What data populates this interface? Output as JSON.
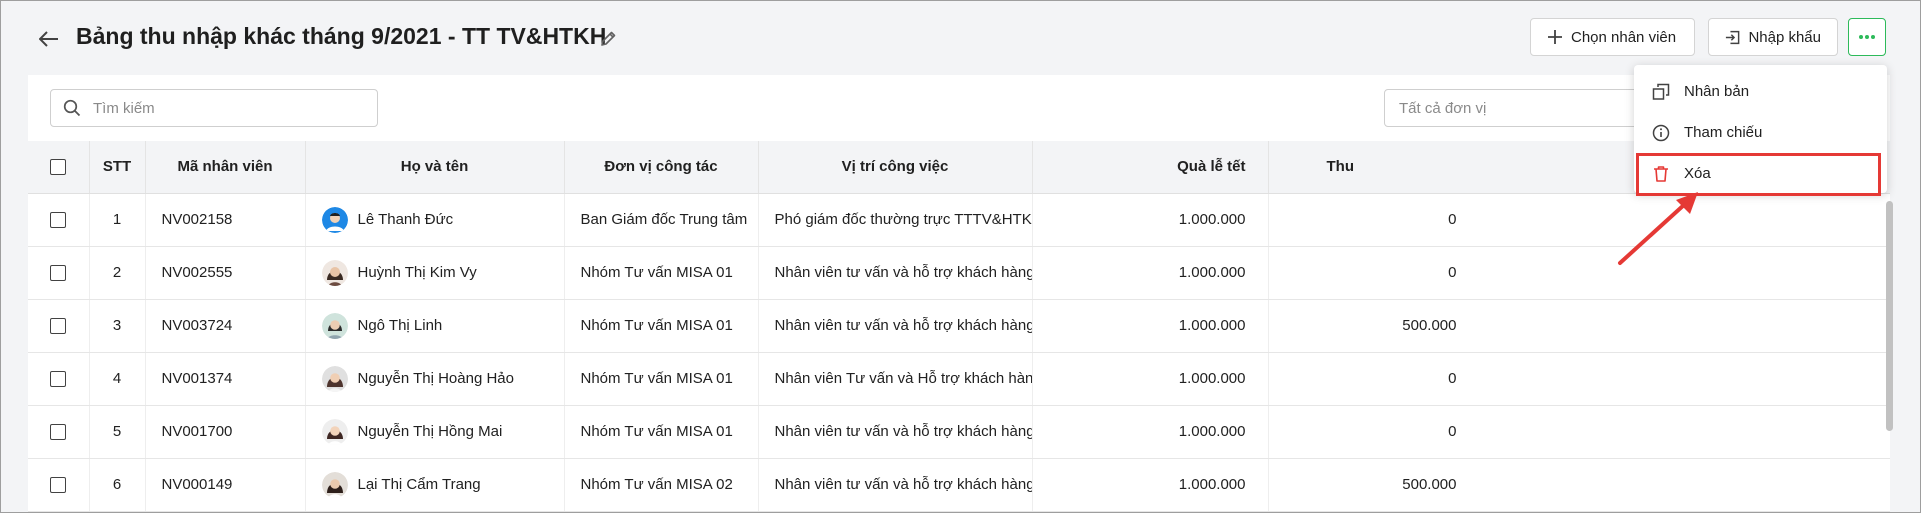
{
  "header": {
    "title": "Bảng thu nhập khác tháng 9/2021 - TT TV&HTKH",
    "choose_employee_label": "Chọn nhân viên",
    "import_label": "Nhập khẩu"
  },
  "toolbar": {
    "search_placeholder": "Tìm kiếm",
    "unit_filter_placeholder": "Tất cả đơn vị"
  },
  "table": {
    "columns": [
      "STT",
      "Mã nhân viên",
      "Họ và tên",
      "Đơn vị công tác",
      "Vị trí công việc",
      "Quà lễ tết",
      "Thu"
    ],
    "rows": [
      {
        "stt": "1",
        "code": "NV002158",
        "name": "Lê Thanh Đức",
        "unit": "Ban Giám đốc Trung tâm",
        "position": "Phó giám đốc thường trực TTTV&HTKH",
        "gift": "1.000.000",
        "other": "0"
      },
      {
        "stt": "2",
        "code": "NV002555",
        "name": "Huỳnh Thị Kim Vy",
        "unit": "Nhóm Tư vấn MISA 01",
        "position": "Nhân viên tư vấn và hỗ trợ khách hàng",
        "gift": "1.000.000",
        "other": "0"
      },
      {
        "stt": "3",
        "code": "NV003724",
        "name": "Ngô Thị Linh",
        "unit": "Nhóm Tư vấn MISA 01",
        "position": "Nhân viên tư vấn và hỗ trợ khách hàng",
        "gift": "1.000.000",
        "other": "500.000"
      },
      {
        "stt": "4",
        "code": "NV001374",
        "name": "Nguyễn Thị Hoàng Hảo",
        "unit": "Nhóm Tư vấn MISA 01",
        "position": "Nhân viên Tư vấn và Hỗ trợ khách hàng",
        "gift": "1.000.000",
        "other": "0"
      },
      {
        "stt": "5",
        "code": "NV001700",
        "name": "Nguyễn Thị Hồng Mai",
        "unit": "Nhóm Tư vấn MISA 01",
        "position": "Nhân viên tư vấn và hỗ trợ khách hàng",
        "gift": "1.000.000",
        "other": "0"
      },
      {
        "stt": "6",
        "code": "NV000149",
        "name": "Lại Thị Cẩm Trang",
        "unit": "Nhóm Tư vấn MISA 02",
        "position": "Nhân viên tư vấn và hỗ trợ khách hàng",
        "gift": "1.000.000",
        "other": "500.000"
      }
    ]
  },
  "more_menu": {
    "items": [
      {
        "label": "Nhân bản",
        "icon": "duplicate-icon"
      },
      {
        "label": "Tham chiếu",
        "icon": "info-icon"
      },
      {
        "label": "Xóa",
        "icon": "trash-icon"
      }
    ]
  },
  "colors": {
    "accent_green": "#2dba5a",
    "highlight_red": "#e53935",
    "delete_red": "#e53935",
    "header_bg": "#f3f4f6"
  }
}
